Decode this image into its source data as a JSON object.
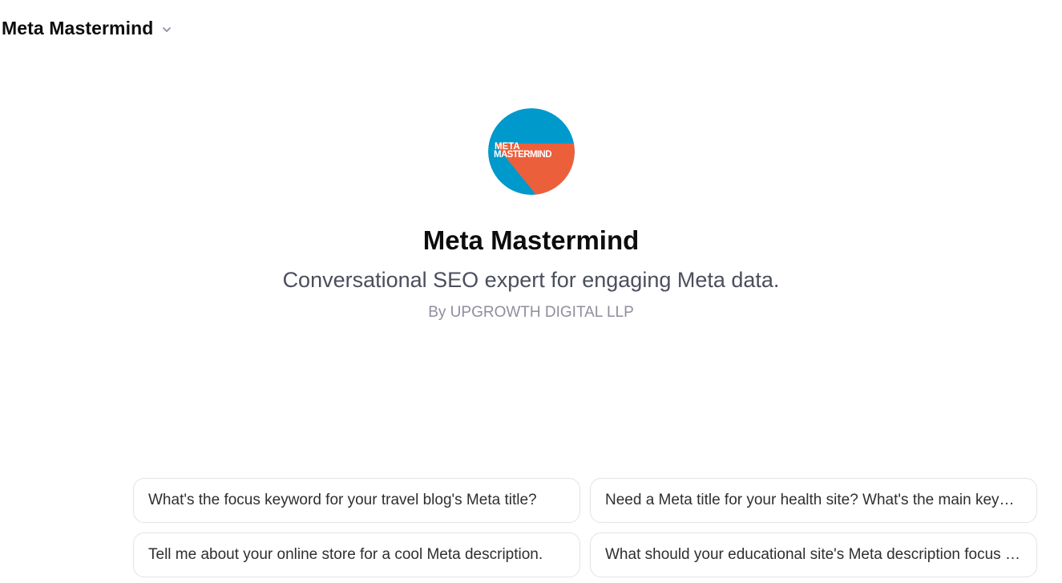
{
  "header": {
    "title": "Meta Mastermind",
    "dropdown_icon": "chevron-down-icon"
  },
  "hero": {
    "logo": {
      "line1": "META",
      "line2": "MASTERMIND",
      "bg_color": "#0099cc",
      "accent_color": "#ec5f3b"
    },
    "name": "Meta Mastermind",
    "description": "Conversational SEO expert for engaging Meta data.",
    "author": "By UPGROWTH DIGITAL LLP"
  },
  "suggestions": [
    {
      "text": "What's the focus keyword for your travel blog's Meta title?"
    },
    {
      "text": "Need a Meta title for your health site? What's the main keyword?"
    },
    {
      "text": "Tell me about your online store for a cool Meta description."
    },
    {
      "text": "What should your educational site's Meta description focus on?"
    }
  ]
}
